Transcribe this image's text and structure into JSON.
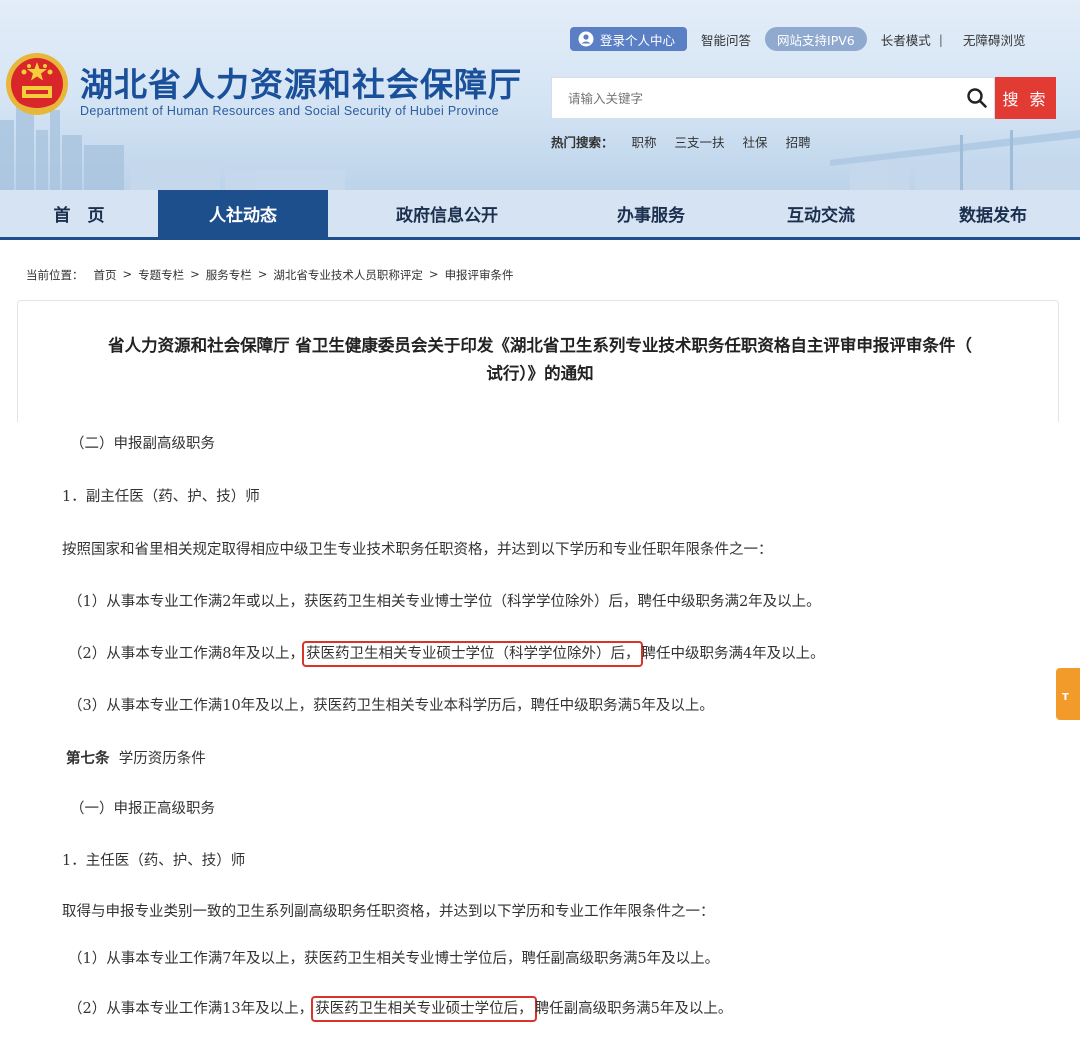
{
  "header": {
    "title": "湖北省人力资源和社会保障厅",
    "subtitle": "Department of Human Resources and Social Security of Hubei Province",
    "login": "登录个人中心",
    "qa": "智能问答",
    "ipv6": "网站支持IPV6",
    "elder": "长者模式",
    "separator": "|",
    "accessible": "无障碍浏览"
  },
  "search": {
    "placeholder": "请输入关键字",
    "button": "搜 索",
    "hot_label": "热门搜索：",
    "hot_items": [
      "职称",
      "三支一扶",
      "社保",
      "招聘"
    ]
  },
  "nav": {
    "items": [
      "首　页",
      "人社动态",
      "政府信息公开",
      "办事服务",
      "互动交流",
      "数据发布"
    ]
  },
  "breadcrumb": {
    "label": "当前位置：",
    "items": [
      "首页",
      ">",
      "专题专栏",
      ">",
      "服务专栏",
      ">",
      "湖北省专业技术人员职称评定",
      ">",
      "申报评审条件"
    ]
  },
  "article": {
    "title_line1": "省人力资源和社会保障厅 省卫生健康委员会关于印发《湖北省卫生系列专业技术职务任职资格自主评审申报评审条件（",
    "title_line2": "试行）》的通知"
  },
  "doc": {
    "p1": "（二）申报副高级职务",
    "p2": "1．副主任医（药、护、技）师",
    "p3": "按照国家和省里相关规定取得相应中级卫生专业技术职务任职资格，并达到以下学历和专业任职年限条件之一：",
    "p4": "（1）从事本专业工作满2年或以上，获医药卫生相关专业博士学位（科学学位除外）后，聘任中级职务满2年及以上。",
    "p5_pre": "（2）从事本专业工作满8年及以上，",
    "p5_hl": "获医药卫生相关专业硕士学位（科学学位除外）后，",
    "p5_post": "聘任中级职务满4年及以上。",
    "p6": "（3）从事本专业工作满10年及以上，获医药卫生相关专业本科学历后，聘任中级职务满5年及以上。",
    "p7_bold": "第七条",
    "p7": "学历资历条件",
    "p8": "（一）申报正高级职务",
    "p9": "1．主任医（药、护、技）师",
    "p10": "取得与申报专业类别一致的卫生系列副高级职务任职资格，并达到以下学历和专业工作年限条件之一：",
    "p11": "（1）从事本专业工作满7年及以上，获医药卫生相关专业博士学位后，聘任副高级职务满5年及以上。",
    "p12_pre": "（2）从事本专业工作满13年及以上，",
    "p12_hl": "获医药卫生相关专业硕士学位后，",
    "p12_post": "聘任副高级职务满5年及以上。"
  },
  "side_tab": "T"
}
